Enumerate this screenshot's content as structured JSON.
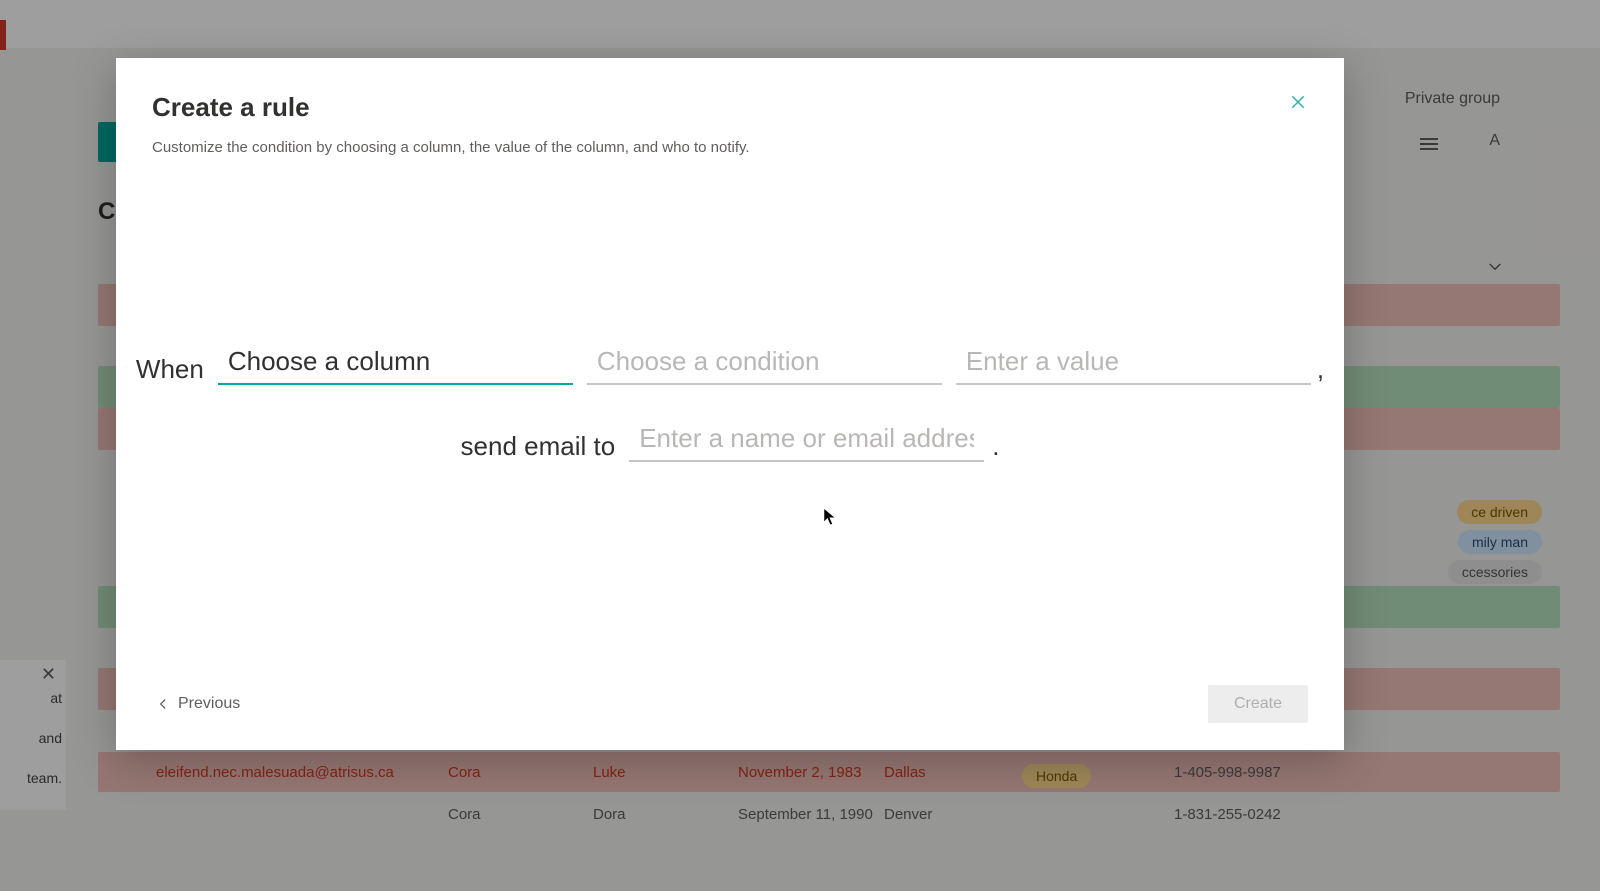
{
  "background": {
    "private_group_label": "Private group",
    "all_items_label": "A",
    "heading_prefix": "Cu",
    "chips": {
      "c1": "ce driven",
      "c2": "mily man",
      "c3": "ccessories"
    },
    "side_panel": {
      "line1": "at",
      "line2": "and",
      "line3": "team."
    },
    "row_visible": {
      "email": "eleifend.nec.malesuada@atrisus.ca",
      "first": "Cora",
      "last": "Luke",
      "dob": "November 2, 1983",
      "city": "Dallas",
      "brand": "Honda",
      "phone": "1-405-998-9987"
    },
    "row_partial": {
      "email": "",
      "first": "Cora",
      "last": "Dora",
      "dob": "September 11, 1990",
      "city": "Denver",
      "brand": "",
      "phone": "1-831-255-0242"
    }
  },
  "modal": {
    "title": "Create a rule",
    "subtitle": "Customize the condition by choosing a column, the value of the column, and who to notify.",
    "sentence": {
      "when": "When",
      "column_placeholder": "Choose a column",
      "condition_placeholder": "Choose a condition",
      "value_placeholder": "Enter a value",
      "send_to": "send email to",
      "recipient_placeholder": "Enter a name or email address"
    },
    "previous_label": "Previous",
    "create_label": "Create"
  }
}
